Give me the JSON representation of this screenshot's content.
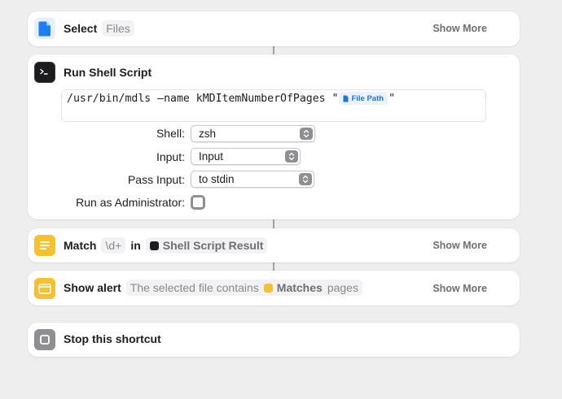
{
  "actions": {
    "select": {
      "title": "Select",
      "token": "Files",
      "show_more": "Show More",
      "icon": "document-icon",
      "color": "#1a7ff7"
    },
    "shell": {
      "title": "Run Shell Script",
      "icon": "terminal-icon",
      "script_text": "/usr/bin/mdls —name kMDItemNumberOfPages \"",
      "script_close": "\"",
      "file_path_token": "File Path",
      "shell_label": "Shell:",
      "shell_value": "zsh",
      "input_label": "Input:",
      "input_value": "Input",
      "pass_input_label": "Pass Input:",
      "pass_input_value": "to stdin",
      "admin_label": "Run as Administrator:",
      "admin_checked": false
    },
    "match": {
      "title": "Match",
      "pattern": "\\d+",
      "in_label": "in",
      "source_token": "Shell Script Result",
      "show_more": "Show More",
      "icon": "match-icon",
      "color": "#f5c131"
    },
    "alert": {
      "title": "Show alert",
      "message_prefix": "The selected file contains",
      "var_token": "Matches",
      "message_suffix": "pages",
      "show_more": "Show More",
      "icon": "window-icon",
      "color": "#f5c131"
    },
    "stop": {
      "title": "Stop this shortcut",
      "icon": "stop-icon",
      "color": "#8e8e93"
    }
  }
}
